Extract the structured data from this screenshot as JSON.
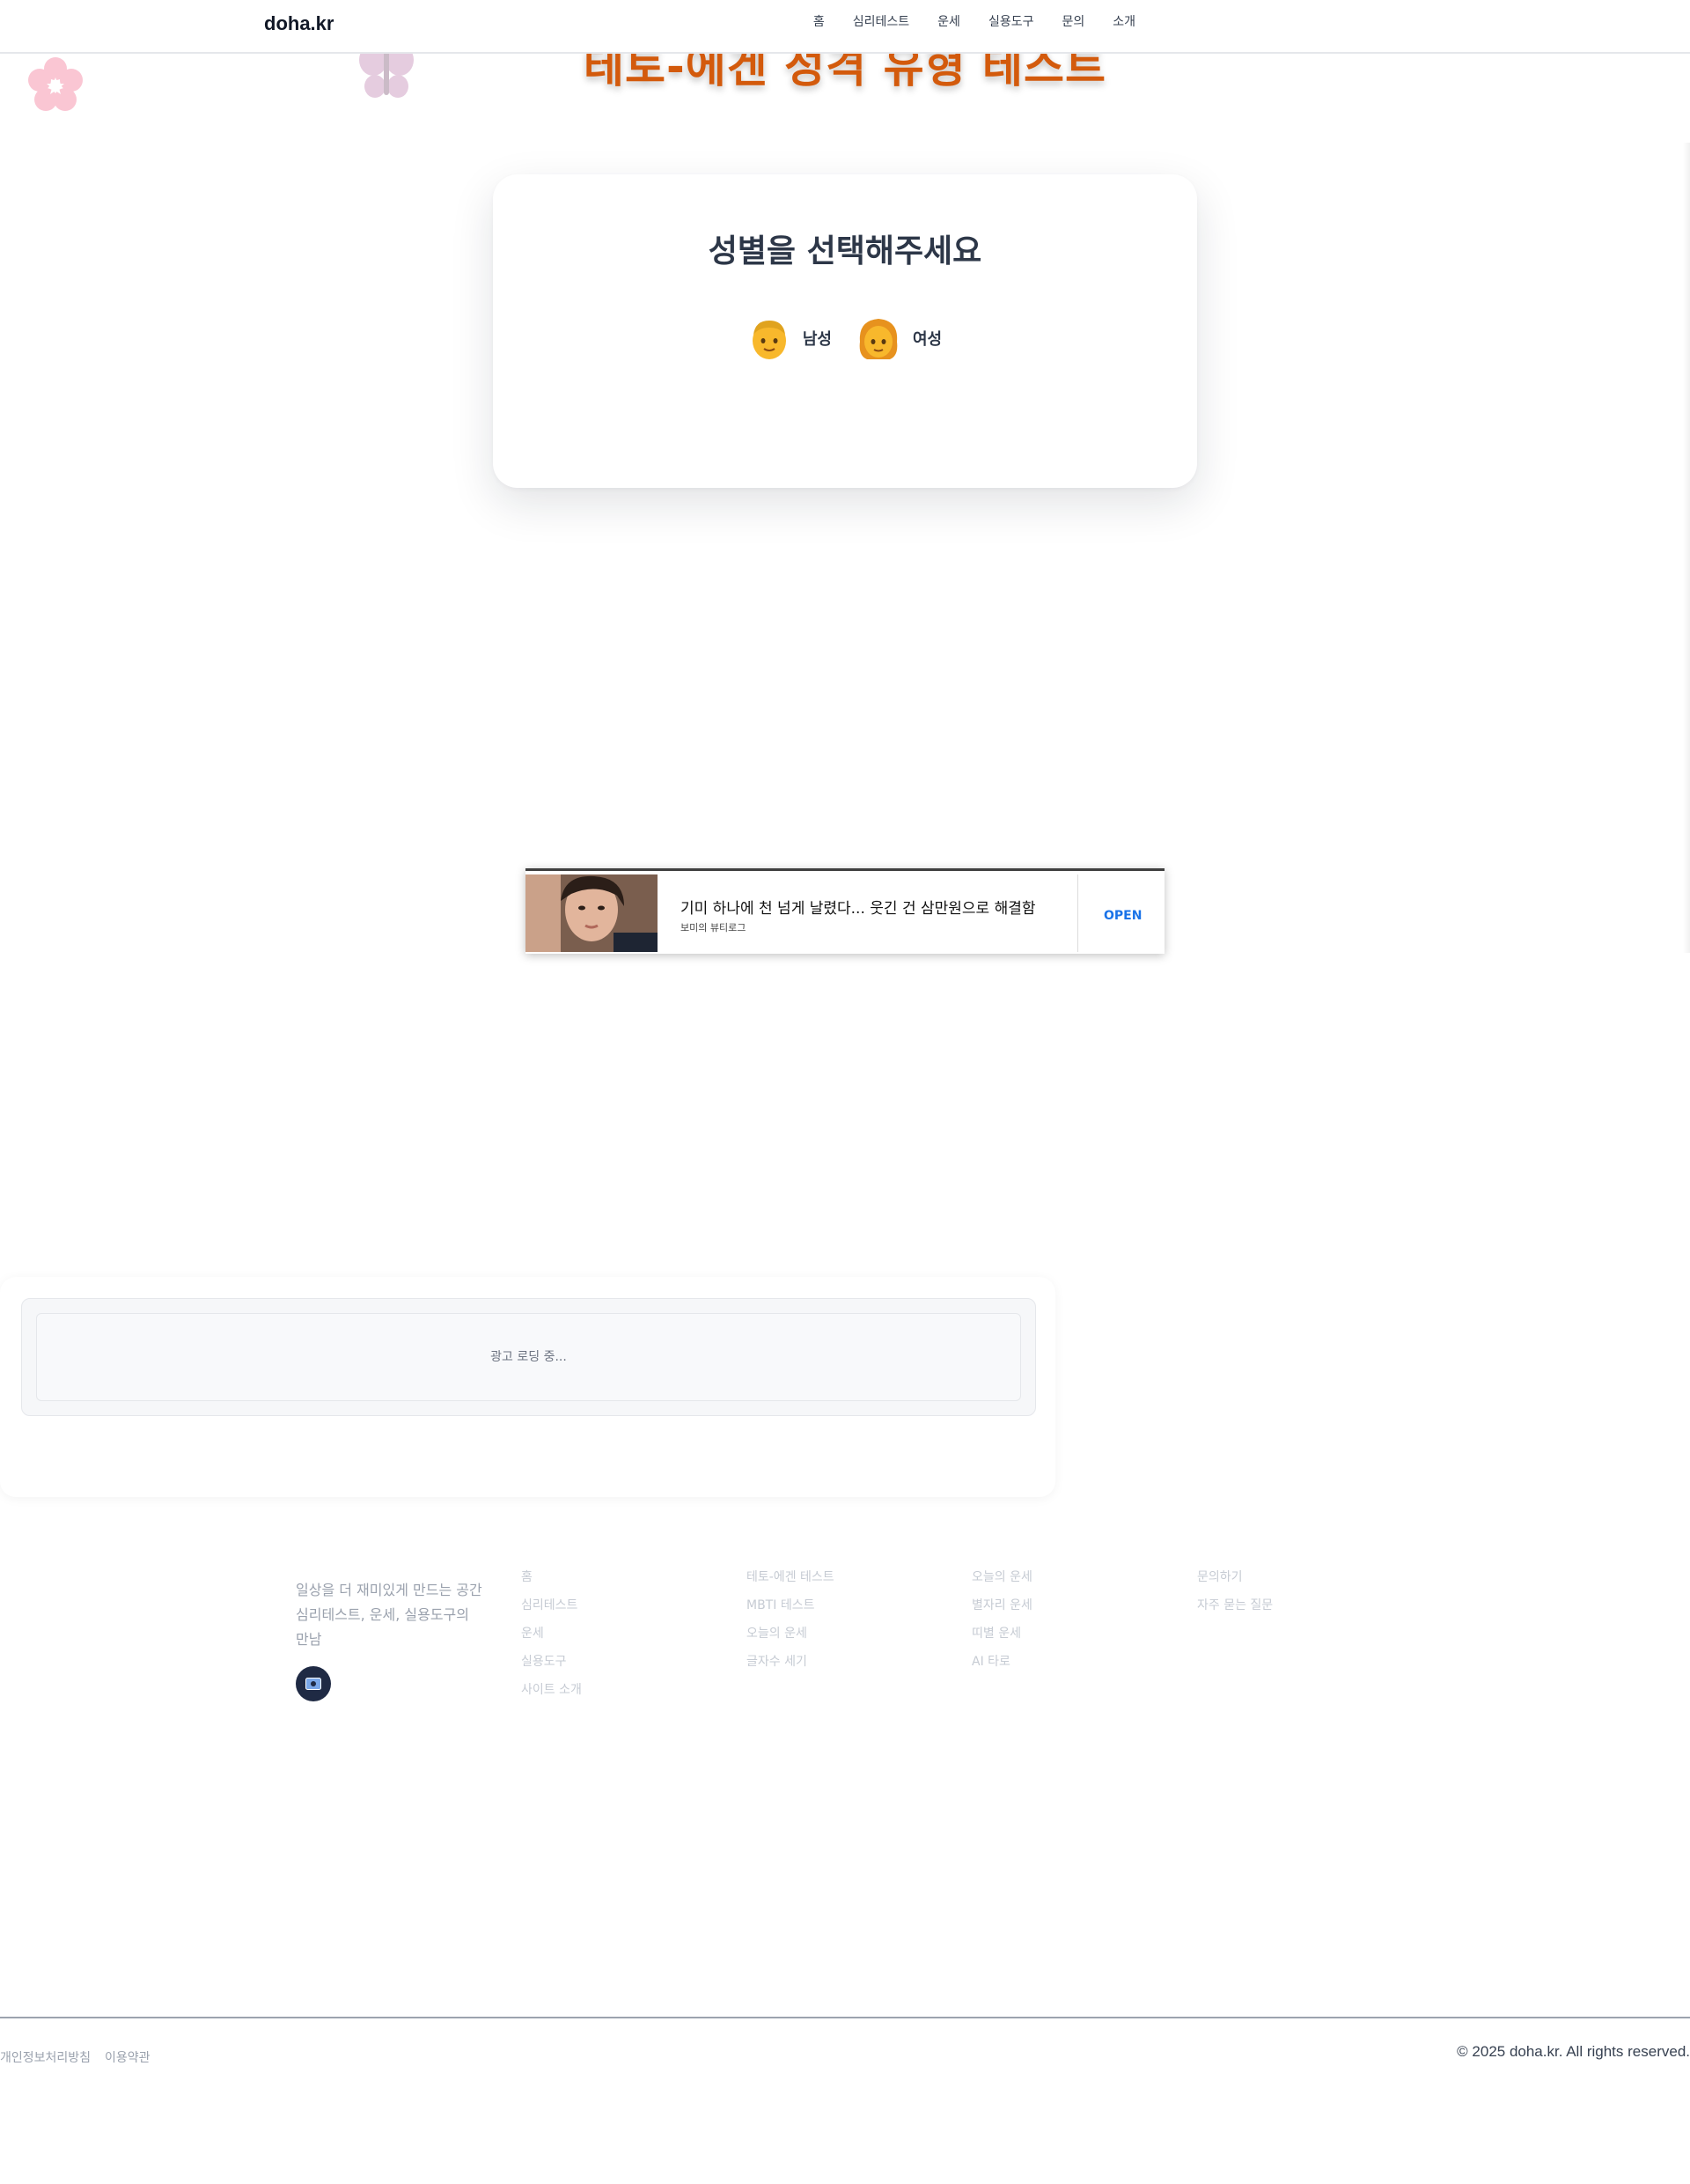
{
  "header": {
    "logo": "doha.kr",
    "nav": [
      "홈",
      "심리테스트",
      "운세",
      "실용도구",
      "문의",
      "소개"
    ]
  },
  "page": {
    "title": "테토-에겐 성격 유형 테스트"
  },
  "gender_card": {
    "title": "성별을 선택해주세요",
    "options": [
      {
        "label": "남성",
        "icon": "man-emoji-icon"
      },
      {
        "label": "여성",
        "icon": "woman-emoji-icon"
      }
    ]
  },
  "ad_banner": {
    "headline": "기미 하나에 천 넘게 날렸다... 웃긴 건 삼만원으로 해결함",
    "source": "보미의 뷰티로그",
    "cta": "OPEN"
  },
  "ad_loading": {
    "text": "광고 로딩 중..."
  },
  "footer": {
    "description": "일상을 더 재미있게 만드는 공간 심리테스트, 운세, 실용도구의 만남",
    "columns": [
      [
        "홈",
        "심리테스트",
        "운세",
        "실용도구",
        "사이트 소개"
      ],
      [
        "테토-에겐 테스트",
        "MBTI 테스트",
        "오늘의 운세",
        "글자수 세기"
      ],
      [
        "오늘의 운세",
        "별자리 운세",
        "띠별 운세",
        "AI 타로"
      ],
      [
        "문의하기",
        "자주 묻는 질문"
      ]
    ],
    "bottom_links": [
      "개인정보처리방침",
      "이용약관"
    ],
    "copyright": "© 2025 doha.kr. All rights reserved."
  },
  "colors": {
    "title_orange": "#d35a0c",
    "text_dark": "#2d3748",
    "ad_cta_blue": "#1a73e8",
    "footer_badge": "#1f2a44"
  }
}
